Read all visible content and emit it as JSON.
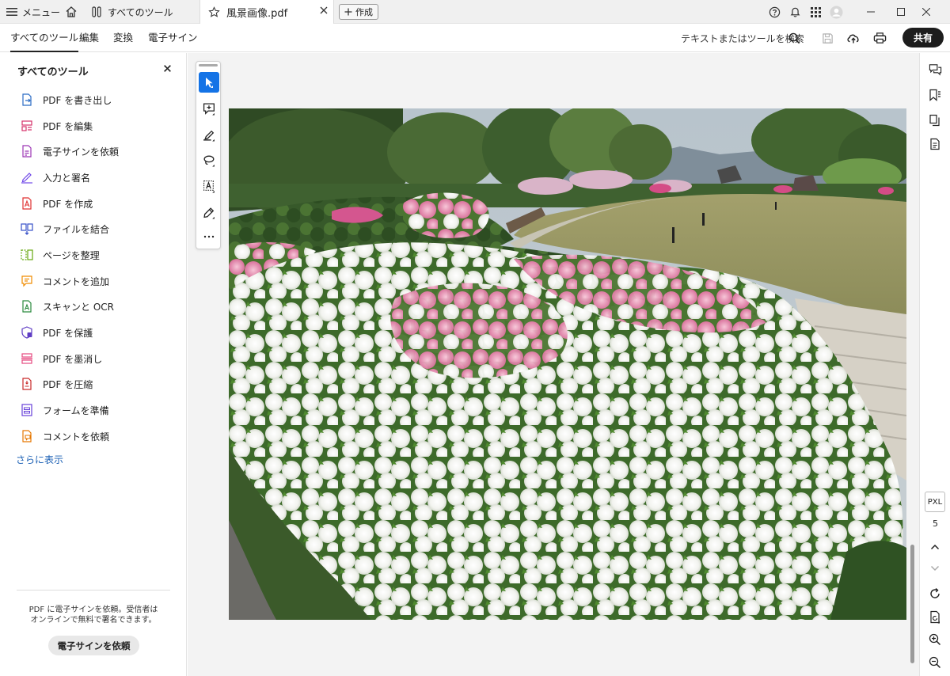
{
  "titlebar": {
    "menu_label": "メニュー",
    "tabs": [
      {
        "label": "すべてのツール"
      },
      {
        "label": "風景画像.pdf"
      }
    ],
    "create_label": "作成"
  },
  "toolbar": {
    "tabs": [
      {
        "label": "すべてのツール"
      },
      {
        "label": "編集"
      },
      {
        "label": "変換"
      },
      {
        "label": "電子サイン"
      }
    ],
    "search_label": "テキストまたはツールを検索",
    "share_label": "共有"
  },
  "sidebar": {
    "title": "すべてのツール",
    "items": [
      {
        "label": "PDF を書き出し",
        "icon": "export-pdf-icon",
        "color": "#2b6cc4"
      },
      {
        "label": "PDF を編集",
        "icon": "edit-pdf-icon",
        "color": "#d6336c"
      },
      {
        "label": "電子サインを依頼",
        "icon": "request-esign-icon",
        "color": "#9c36b5"
      },
      {
        "label": "入力と署名",
        "icon": "fill-sign-icon",
        "color": "#7048e8"
      },
      {
        "label": "PDF を作成",
        "icon": "create-pdf-icon",
        "color": "#e03131"
      },
      {
        "label": "ファイルを結合",
        "icon": "combine-files-icon",
        "color": "#364fc7"
      },
      {
        "label": "ページを整理",
        "icon": "organize-pages-icon",
        "color": "#66a80f"
      },
      {
        "label": "コメントを追加",
        "icon": "add-comment-icon",
        "color": "#f08c00"
      },
      {
        "label": "スキャンと OCR",
        "icon": "scan-ocr-icon",
        "color": "#2b8a3e"
      },
      {
        "label": "PDF を保護",
        "icon": "protect-pdf-icon",
        "color": "#5f3dc4"
      },
      {
        "label": "PDF を墨消し",
        "icon": "redact-pdf-icon",
        "color": "#e64980"
      },
      {
        "label": "PDF を圧縮",
        "icon": "compress-pdf-icon",
        "color": "#c92a2a"
      },
      {
        "label": "フォームを準備",
        "icon": "prepare-form-icon",
        "color": "#6741d9"
      },
      {
        "label": "コメントを依頼",
        "icon": "request-comments-icon",
        "color": "#e67700"
      }
    ],
    "show_more": "さらに表示",
    "promo_text": "PDF に電子サインを依頼。受信者は\nオンラインで無料で署名できます。",
    "promo_button": "電子サインを依頼"
  },
  "viewer": {
    "zoom_mode": "PXL",
    "page_number": "5"
  }
}
